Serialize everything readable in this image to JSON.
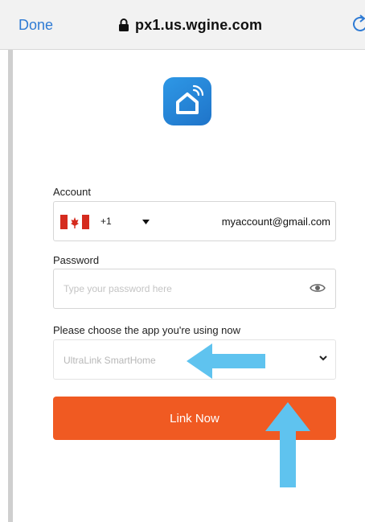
{
  "browser": {
    "done_label": "Done",
    "url": "px1.us.wgine.com",
    "lock_icon": "lock-icon",
    "reload_icon": "reload-icon"
  },
  "app": {
    "logo_icon": "smart-home-icon"
  },
  "form": {
    "account_label": "Account",
    "country_code": "+1",
    "country_flag": "canada-flag",
    "account_value": "myaccount@gmail.com",
    "password_label": "Password",
    "password_placeholder": "Type your password here",
    "app_choice_label": "Please choose the app you're using now",
    "app_choice_value": "UltraLink SmartHome",
    "submit_label": "Link Now"
  },
  "colors": {
    "accent": "#f05a22",
    "link_blue": "#2f7bd4",
    "logo_blue": "#2e98e6",
    "annotation_arrow": "#5fc3ef"
  }
}
